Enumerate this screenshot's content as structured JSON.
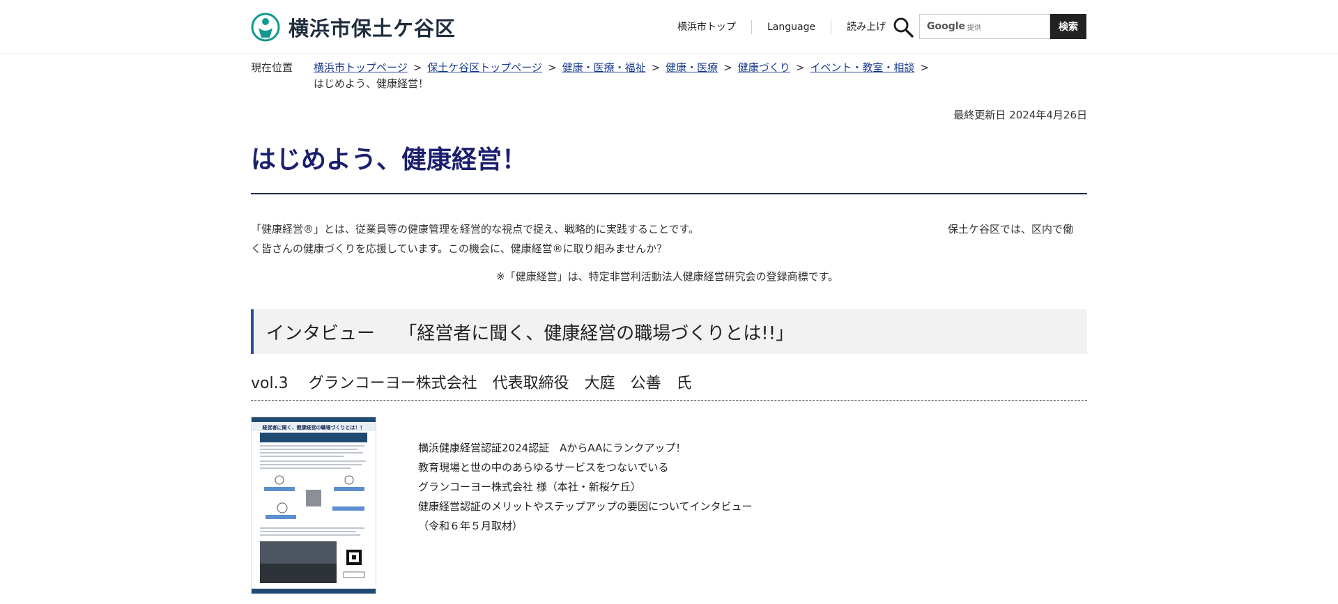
{
  "site": {
    "title": "横浜市保土ケ谷区"
  },
  "header_nav": [
    {
      "label": "横浜市トップ"
    },
    {
      "label": "Language"
    },
    {
      "label": "読み上げ"
    }
  ],
  "search": {
    "placeholder_brand": "Google",
    "placeholder_suffix": "提供",
    "button": "検索"
  },
  "breadcrumb": {
    "label": "現在位置",
    "items": [
      {
        "label": "横浜市トップページ"
      },
      {
        "label": "保土ケ谷区トップページ"
      },
      {
        "label": "健康・医療・福祉"
      },
      {
        "label": "健康・医療"
      },
      {
        "label": "健康づくり"
      },
      {
        "label": "イベント・教室・相談"
      }
    ],
    "separator": ">",
    "current": "はじめよう、健康経営！"
  },
  "last_updated": "最終更新日  2024年4月26日",
  "page_title": "はじめよう、健康経営！",
  "intro": {
    "line1": "「健康経営®」とは、従業員等の健康管理を経営的な視点で捉え、戦略的に実践することです。",
    "line1_right": "保土ケ谷区では、区内で働",
    "line2": "く皆さんの健康づくりを応援しています。この機会に、健康経営®に取り組みませんか？",
    "note": "※「健康経営」は、特定非営利活動法人健康経営研究会の登録商標です。"
  },
  "section": {
    "heading": "インタビュー　 「経営者に聞く、健康経営の職場づくりとは!!」",
    "subheading": "vol.3　 グランコーヨー株式会社　代表取締役　大庭　公善　氏"
  },
  "article": {
    "thumb_title": "経営者に聞く、健康経営の職場づくりとは！！",
    "lines": [
      "横浜健康経営認証2024認証　AからAAにランクアップ！",
      "教育現場と世の中のあらゆるサービスをつないでいる",
      "グランコーヨー株式会社 様（本社・新桜ケ丘）",
      "健康経営認証のメリットやステップアップの要因についてインタビュー",
      "（令和６年５月取材）"
    ]
  },
  "colors": {
    "title": "#1b1f6e",
    "link": "#1a3d8f",
    "accent": "#2a4fa0",
    "logo": "#0f9a8e"
  }
}
